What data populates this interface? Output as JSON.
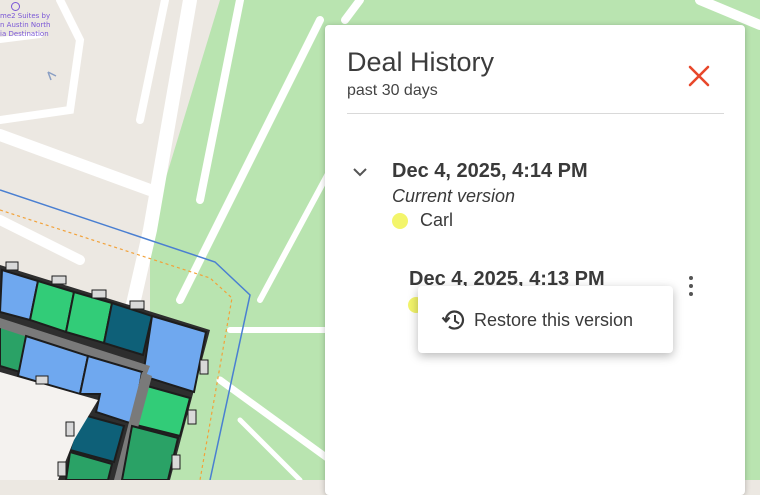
{
  "map": {
    "poi_label": "me2 Suites by\nn Austin North\nia Destination"
  },
  "panel": {
    "title": "Deal History",
    "subtitle": "past 30 days",
    "close_icon": "close-icon",
    "versions": [
      {
        "date": "Dec 4, 2025, 4:14 PM",
        "status": "Current version",
        "user": "Carl",
        "expanded": true
      },
      {
        "date": "Dec 4, 2025, 4:13 PM"
      }
    ]
  },
  "context_menu": {
    "items": [
      {
        "icon": "history-icon",
        "label": "Restore this version"
      }
    ]
  },
  "colors": {
    "accent_close": "#e8472b",
    "user_dot": "#f3f56b",
    "unit_blue": "#6fa8ef",
    "unit_green": "#32cc78",
    "unit_darkteal": "#0e6078",
    "park_green": "#b9e4b0"
  }
}
